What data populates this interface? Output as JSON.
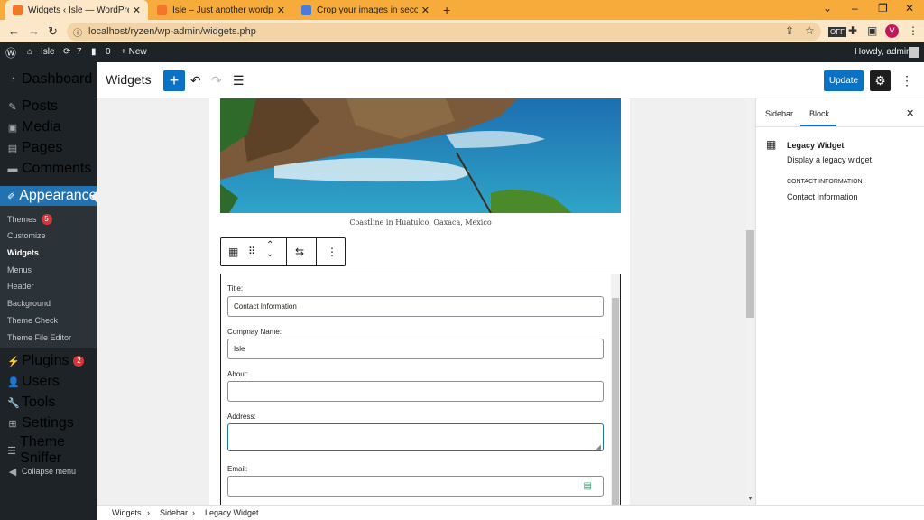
{
  "browser": {
    "tabs": [
      {
        "title": "Widgets ‹ Isle — WordPress",
        "favicon_color": "#f5752a"
      },
      {
        "title": "Isle – Just another wordpress the",
        "favicon_color": "#f5752a"
      },
      {
        "title": "Crop your images in seconds for",
        "favicon_color": "#4a7bd8"
      }
    ],
    "url": "localhost/ryzen/wp-admin/widgets.php",
    "profile_initial": "V"
  },
  "wp_admin_bar": {
    "site_name": "Isle",
    "updates_count": "7",
    "comments_count": "0",
    "new_label": "+ New",
    "howdy": "Howdy, admin"
  },
  "admin_menu": {
    "items": [
      {
        "label": "Dashboard",
        "icon": "dashboard-icon"
      },
      {
        "label": "Posts",
        "icon": "pin-icon"
      },
      {
        "label": "Media",
        "icon": "media-icon"
      },
      {
        "label": "Pages",
        "icon": "pages-icon"
      },
      {
        "label": "Comments",
        "icon": "comments-icon"
      },
      {
        "label": "Appearance",
        "icon": "brush-icon"
      }
    ],
    "appearance_sub": [
      {
        "label": "Themes",
        "badge": "5"
      },
      {
        "label": "Customize"
      },
      {
        "label": "Widgets"
      },
      {
        "label": "Menus"
      },
      {
        "label": "Header"
      },
      {
        "label": "Background"
      },
      {
        "label": "Theme Check"
      },
      {
        "label": "Theme File Editor"
      }
    ],
    "lower": [
      {
        "label": "Plugins",
        "badge": "2",
        "icon": "plug-icon"
      },
      {
        "label": "Users",
        "icon": "user-icon"
      },
      {
        "label": "Tools",
        "icon": "wrench-icon"
      },
      {
        "label": "Settings",
        "icon": "settings-icon"
      },
      {
        "label": "Theme Sniffer",
        "icon": "list-icon"
      },
      {
        "label": "Collapse menu",
        "icon": "collapse-icon"
      }
    ]
  },
  "editor": {
    "title": "Widgets",
    "update_label": "Update",
    "image_caption": "Coastline in Huatulco, Oaxaca, Mexico",
    "form": {
      "title_label": "Title:",
      "title_value": "Contact Information",
      "company_label": "Compnay Name:",
      "company_value": "Isle",
      "about_label": "About:",
      "about_value": "",
      "address_label": "Address:",
      "address_value": "",
      "email_label": "Email:",
      "email_value": ""
    }
  },
  "sidebar_panel": {
    "tab_sidebar": "Sidebar",
    "tab_block": "Block",
    "block_name": "Legacy Widget",
    "block_desc": "Display a legacy widget.",
    "widget_heading": "CONTACT INFORMATION",
    "widget_subtitle": "Contact Information"
  },
  "breadcrumb": {
    "items": [
      "Widgets",
      "Sidebar",
      "Legacy Widget"
    ]
  },
  "colors": {
    "wp_blue": "#0a72c4",
    "admin_dark": "#1d2327",
    "chrome_orange": "#f6ab3a"
  }
}
